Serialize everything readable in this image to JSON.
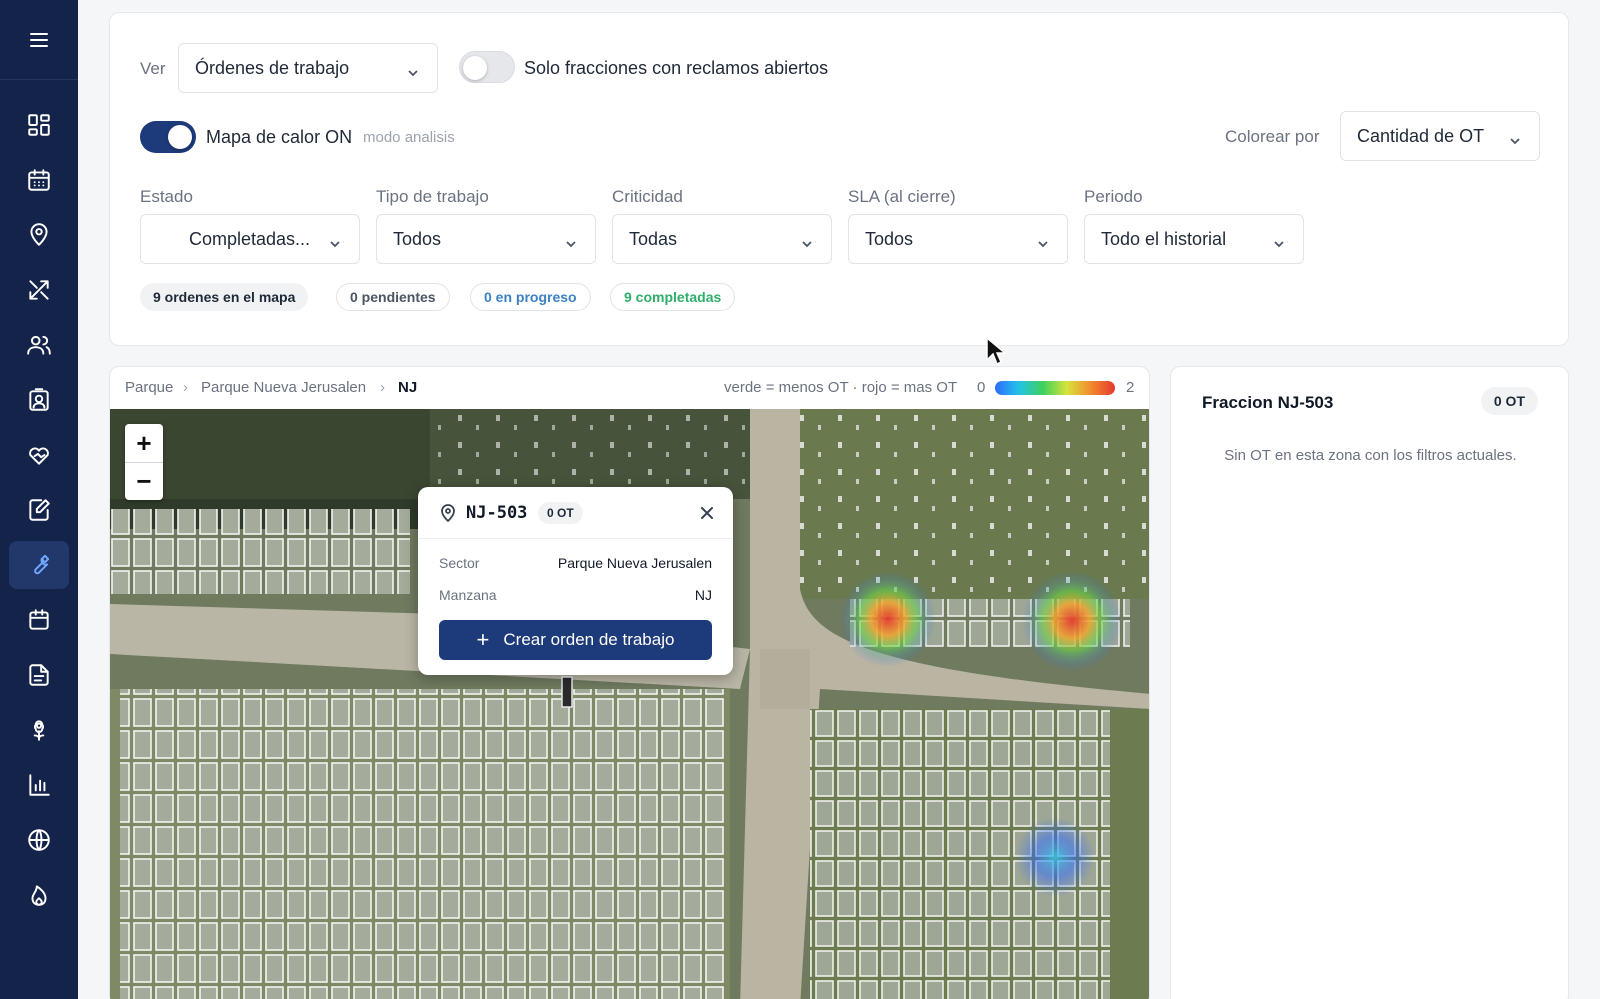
{
  "sidebar": {
    "items": [
      {
        "icon": "dashboard-icon"
      },
      {
        "icon": "calendar-icon"
      },
      {
        "icon": "map-pin-icon"
      },
      {
        "icon": "tools-icon"
      },
      {
        "icon": "users-icon"
      },
      {
        "icon": "id-badge-icon"
      },
      {
        "icon": "heart-hand-icon"
      },
      {
        "icon": "edit-document-icon"
      },
      {
        "icon": "wrench-icon",
        "active": true
      },
      {
        "icon": "calendar-small-icon"
      },
      {
        "icon": "document-icon"
      },
      {
        "icon": "flower-icon"
      },
      {
        "icon": "bar-chart-icon"
      },
      {
        "icon": "globe-icon"
      },
      {
        "icon": "flame-icon"
      }
    ]
  },
  "filters": {
    "ver_label": "Ver",
    "ver_value": "Órdenes de trabajo",
    "solo_toggle_label": "Solo fracciones con reclamos abiertos",
    "solo_toggle_on": false,
    "heat_toggle_label": "Mapa de calor ON",
    "heat_toggle_on": true,
    "heat_mode": "modo analisis",
    "colorear_label": "Colorear por",
    "colorear_value": "Cantidad de OT",
    "estado_label": "Estado",
    "estado_value": "Completadas...",
    "tipo_label": "Tipo de trabajo",
    "tipo_value": "Todos",
    "criticidad_label": "Criticidad",
    "criticidad_value": "Todas",
    "sla_label": "SLA (al cierre)",
    "sla_value": "Todos",
    "periodo_label": "Periodo",
    "periodo_value": "Todo el historial",
    "chips": [
      "9 ordenes en el mapa",
      "0 pendientes",
      "0 en progreso",
      "9 completadas"
    ]
  },
  "map": {
    "breadcrumb": [
      "Parque",
      "Parque Nueva Jerusalen",
      "NJ"
    ],
    "legend_text": "verde = menos OT · rojo = mas OT",
    "legend_min": "0",
    "legend_max": "2",
    "popup": {
      "title": "NJ-503",
      "badge": "0 OT",
      "sector_label": "Sector",
      "sector_value": "Parque Nueva Jerusalen",
      "manzana_label": "Manzana",
      "manzana_value": "NJ",
      "button_label": "Crear orden de trabajo"
    }
  },
  "panel": {
    "title": "Fraccion NJ-503",
    "badge": "0 OT",
    "message": "Sin OT en esta zona con los filtros actuales."
  },
  "colors": {
    "sidebar_bg": "#14234a",
    "primary": "#1d3a7a",
    "in_progress": "#3b82c4",
    "completed": "#2fae6b"
  }
}
